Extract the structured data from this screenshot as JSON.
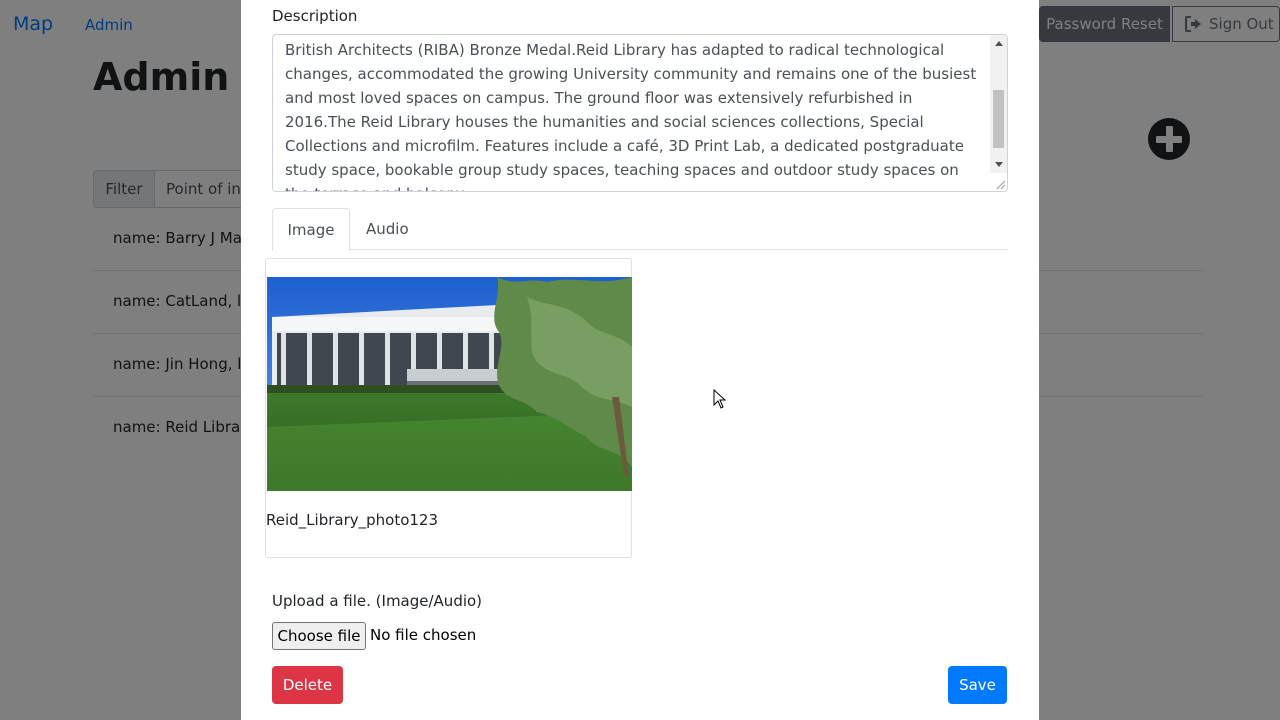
{
  "navbar": {
    "brand": "Map",
    "admin_link": "Admin",
    "password_reset": "Password Reset",
    "sign_out": "Sign Out"
  },
  "page": {
    "title": "Admin P",
    "filter_label": "Filter",
    "filter_value": "Point of int",
    "items": [
      {
        "label": "name: Barry J Mars"
      },
      {
        "label": "name: CatLand, lat"
      },
      {
        "label": "name: Jin Hong, la"
      },
      {
        "label": "name: Reid Library"
      }
    ]
  },
  "modal": {
    "description_label": "Description",
    "description_text": "British Architects (RIBA) Bronze Medal.Reid Library has adapted to radical technological changes, accommodated the growing University community and remains one of the busiest and most loved spaces on campus. The ground floor was extensively refurbished in 2016.The Reid Library houses the humanities and social sciences collections, Special Collections and microfilm. Features include a café, 3D Print Lab, a dedicated postgraduate study space, bookable group study spaces, teaching spaces and outdoor study spaces on the terrace and balcony.",
    "tabs": [
      {
        "label": "Image",
        "active": true
      },
      {
        "label": "Audio",
        "active": false
      }
    ],
    "media_card": {
      "caption": "Reid_Library_photo123"
    },
    "upload_label": "Upload a file. (Image/Audio)",
    "choose_file": "Choose file",
    "no_file": "No file chosen",
    "delete_button": "Delete",
    "save_button": "Save"
  },
  "colors": {
    "primary": "#007bff",
    "danger": "#dc3545",
    "secondary": "#6c757d"
  },
  "icons": [
    "sign-out-icon",
    "plus-circle-icon",
    "scroll-up-arrow-icon",
    "scroll-down-arrow-icon",
    "resize-grip-icon",
    "mouse-cursor-icon"
  ]
}
